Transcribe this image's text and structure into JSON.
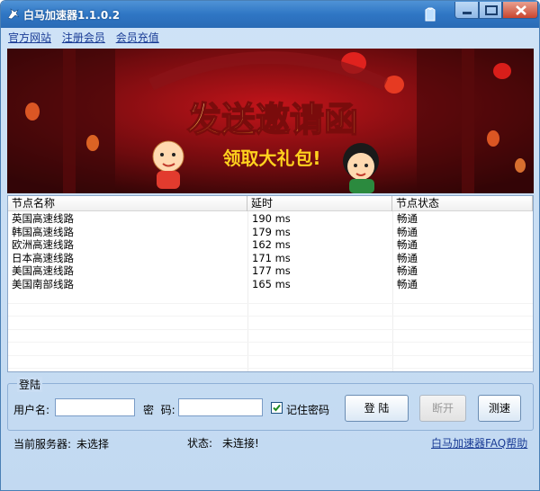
{
  "window": {
    "title": "白马加速器1.1.0.2"
  },
  "toplinks": [
    {
      "label": "官方网站"
    },
    {
      "label": "注册会员"
    },
    {
      "label": "会员充值"
    }
  ],
  "banner": {
    "headline": "发送邀请函",
    "subline": "领取大礼包!"
  },
  "list": {
    "columns": [
      "节点名称",
      "延时",
      "节点状态"
    ],
    "rows": [
      {
        "name": "英国高速线路",
        "latency": "190 ms",
        "status": "畅通"
      },
      {
        "name": "韩国高速线路",
        "latency": "179 ms",
        "status": "畅通"
      },
      {
        "name": "欧洲高速线路",
        "latency": "162 ms",
        "status": "畅通"
      },
      {
        "name": "日本高速线路",
        "latency": "171 ms",
        "status": "畅通"
      },
      {
        "name": "美国高速线路",
        "latency": "177 ms",
        "status": "畅通"
      },
      {
        "name": "美国南部线路",
        "latency": "165 ms",
        "status": "畅通"
      }
    ]
  },
  "login": {
    "legend": "登陆",
    "username_label": "用户名:",
    "username_value": "",
    "password_label": "密  码:",
    "password_value": "",
    "remember_label": "记住密码",
    "remember_checked": true,
    "login_button": "登 陆",
    "disconnect_button": "断开",
    "speedtest_button": "测速"
  },
  "statusbar": {
    "server_label": "当前服务器:",
    "server_value": "未选择",
    "state_label": "状态:",
    "state_value": "未连接!",
    "faq_link": "白马加速器FAQ帮助"
  },
  "colors": {
    "titlebar": "#2f76c4",
    "window_bg": "#c9ddf3",
    "link": "#1a3c96",
    "banner_red": "#b3121a",
    "banner_gold": "#ffd21e"
  }
}
